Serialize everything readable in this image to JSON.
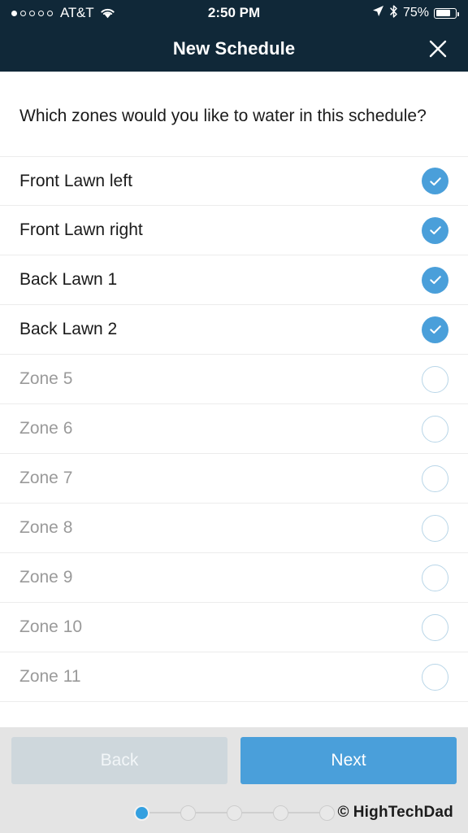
{
  "status_bar": {
    "carrier": "AT&T",
    "signal_dots_total": 5,
    "signal_dots_filled": 1,
    "time": "2:50 PM",
    "battery_percent": "75%",
    "battery_level": 75,
    "icons": [
      "wifi-icon",
      "location-arrow-icon",
      "bluetooth-icon",
      "battery-icon"
    ]
  },
  "nav": {
    "title": "New Schedule",
    "close_icon": "close-icon"
  },
  "main": {
    "question": "Which zones would you like to water in this schedule?",
    "zones": [
      {
        "label": "Front Lawn left",
        "selected": true
      },
      {
        "label": "Front Lawn right",
        "selected": true
      },
      {
        "label": "Back Lawn 1",
        "selected": true
      },
      {
        "label": "Back Lawn 2",
        "selected": true
      },
      {
        "label": "Zone 5",
        "selected": false
      },
      {
        "label": "Zone 6",
        "selected": false
      },
      {
        "label": "Zone 7",
        "selected": false
      },
      {
        "label": "Zone 8",
        "selected": false
      },
      {
        "label": "Zone 9",
        "selected": false
      },
      {
        "label": "Zone 10",
        "selected": false
      },
      {
        "label": "Zone 11",
        "selected": false
      }
    ]
  },
  "footer": {
    "back_label": "Back",
    "back_enabled": false,
    "next_label": "Next",
    "next_enabled": true,
    "steps_total": 5,
    "current_step": 1,
    "watermark": "HighTechDad",
    "watermark_symbol": "©"
  },
  "colors": {
    "header_navy": "#102838",
    "accent_blue": "#4a9fda",
    "step_blue": "#34a0e0",
    "disabled_gray": "#ced7dc",
    "bar_gray": "#e4e4e4",
    "muted_text": "#9a9a9a"
  }
}
